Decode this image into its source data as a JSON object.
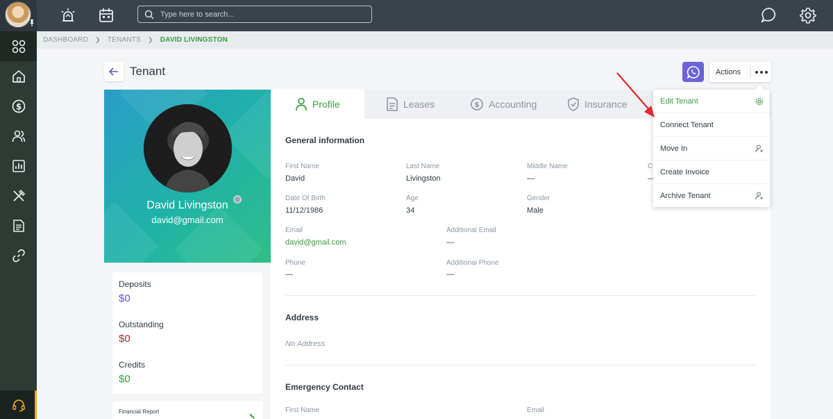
{
  "topbar": {
    "search_placeholder": "Type here to search..."
  },
  "breadcrumb": {
    "items": [
      "DASHBOARD",
      "TENANTS",
      "DAVID LIVINGSTON"
    ]
  },
  "page": {
    "title": "Tenant",
    "actions_label": "Actions"
  },
  "profile": {
    "name": "David Livingston",
    "email": "david@gmail.com"
  },
  "summary": {
    "deposits_label": "Deposits",
    "deposits_value": "$0",
    "outstanding_label": "Outstanding",
    "outstanding_value": "$0",
    "credits_label": "Credits",
    "credits_value": "$0",
    "financial_report_label": "Financial Report",
    "colors": {
      "deposits": "#5b56c9",
      "outstanding": "#b3262f",
      "credits": "#3a9b3f"
    }
  },
  "tabs": [
    {
      "label": "Profile",
      "icon": "person-icon"
    },
    {
      "label": "Leases",
      "icon": "document-icon"
    },
    {
      "label": "Accounting",
      "icon": "dollar-icon"
    },
    {
      "label": "Insurance",
      "icon": "shield-icon"
    }
  ],
  "general": {
    "title": "General information",
    "first_name_label": "First Name",
    "first_name": "David",
    "last_name_label": "Last Name",
    "last_name": "Livingston",
    "middle_name_label": "Middle Name",
    "middle_name": "—",
    "company_label_partial": "C",
    "company_value_partial": "—",
    "dob_label": "Date Of Birth",
    "dob": "11/12/1986",
    "age_label": "Age",
    "age": "34",
    "gender_label": "Gender",
    "gender": "Male",
    "email_label": "Email",
    "email": "david@gmail.com",
    "additional_email_label": "Additional Email",
    "additional_email": "—",
    "phone_label": "Phone",
    "phone": "—",
    "additional_phone_label": "Additional Phone",
    "additional_phone": "—"
  },
  "address": {
    "title": "Address",
    "value": "No Address"
  },
  "emergency": {
    "title": "Emergency Contact",
    "first_name_label": "First Name",
    "email_label": "Email"
  },
  "dropdown": {
    "items": [
      "Edit Tenant",
      "Connect Tenant",
      "Move In",
      "Create Invoice",
      "Archive Tenant"
    ]
  },
  "colors": {
    "brand_green": "#3a9b3f",
    "chat_purple": "#6b63d6",
    "topbar": "#3a434c",
    "sidebar": "#2e3a33"
  }
}
